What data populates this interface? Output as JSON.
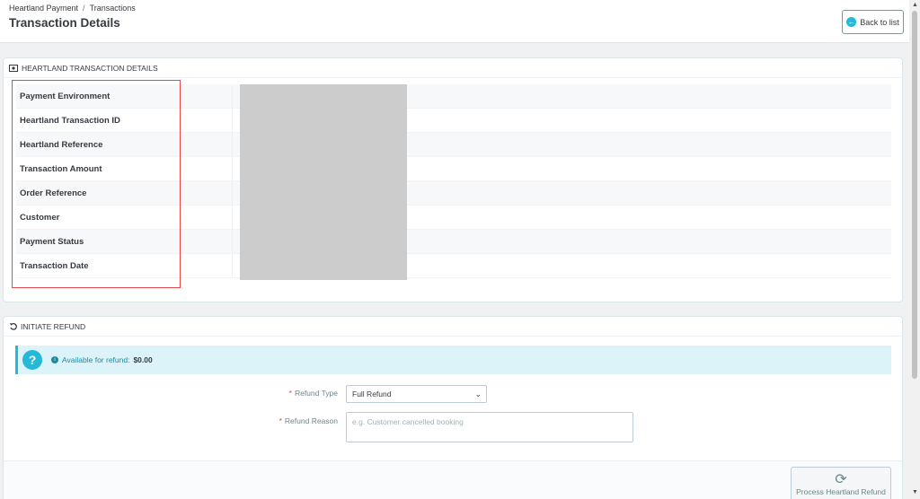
{
  "breadcrumb": {
    "parent": "Heartland Payment",
    "separator": "/",
    "current": "Transactions"
  },
  "page_title": "Transaction Details",
  "back_button": {
    "label": "Back to list",
    "icon": "arrow-left-circle-icon"
  },
  "details_panel": {
    "title": "HEARTLAND TRANSACTION DETAILS",
    "icon": "money-icon",
    "rows": [
      {
        "label": "Payment Environment"
      },
      {
        "label": "Heartland Transaction ID"
      },
      {
        "label": "Heartland Reference"
      },
      {
        "label": "Transaction Amount"
      },
      {
        "label": "Order Reference"
      },
      {
        "label": "Customer"
      },
      {
        "label": "Payment Status"
      },
      {
        "label": "Transaction Date"
      }
    ]
  },
  "refund_panel": {
    "title": "INITIATE REFUND",
    "icon": "undo-icon",
    "alert": {
      "text": "Available for refund:",
      "amount": "$0.00"
    },
    "refund_type": {
      "required": "*",
      "label": "Refund Type",
      "value": "Full Refund"
    },
    "refund_reason": {
      "required": "*",
      "label": "Refund Reason",
      "placeholder": "e.g. Customer cancelled booking"
    },
    "process_button": {
      "label": "Process Heartland Refund",
      "icon": "refresh-icon"
    }
  },
  "colors": {
    "accent": "#25b9d7",
    "highlight": "#e8474c",
    "redacted": "#cccccc"
  }
}
